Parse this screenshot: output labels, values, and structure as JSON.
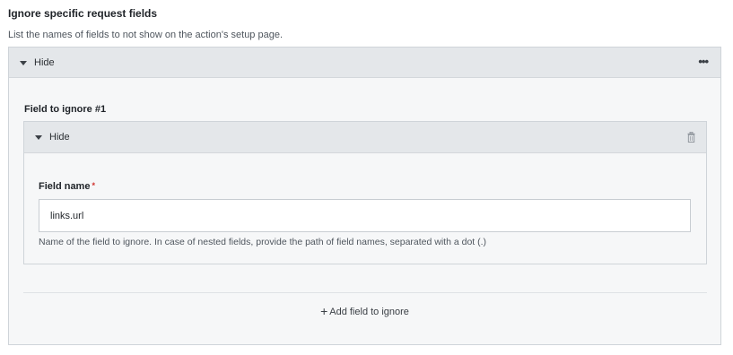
{
  "section": {
    "title": "Ignore specific request fields",
    "description": "List the names of fields to not show on the action's setup page."
  },
  "outer_panel": {
    "toggle_label": "Hide",
    "more_icon": "more-horizontal-icon",
    "add_button_label": "Add field to ignore",
    "add_icon": "plus-icon"
  },
  "item": {
    "title": "Field to ignore #1",
    "toggle_label": "Hide",
    "delete_icon": "trash-icon",
    "field": {
      "label": "Field name",
      "required_marker": "*",
      "value": "links.url",
      "help": "Name of the field to ignore. In case of nested fields, provide the path of field names, separated with a dot (.)"
    }
  },
  "colors": {
    "header_bg": "#e4e7ea",
    "panel_bg": "#f6f7f8",
    "required": "#d0312d"
  }
}
